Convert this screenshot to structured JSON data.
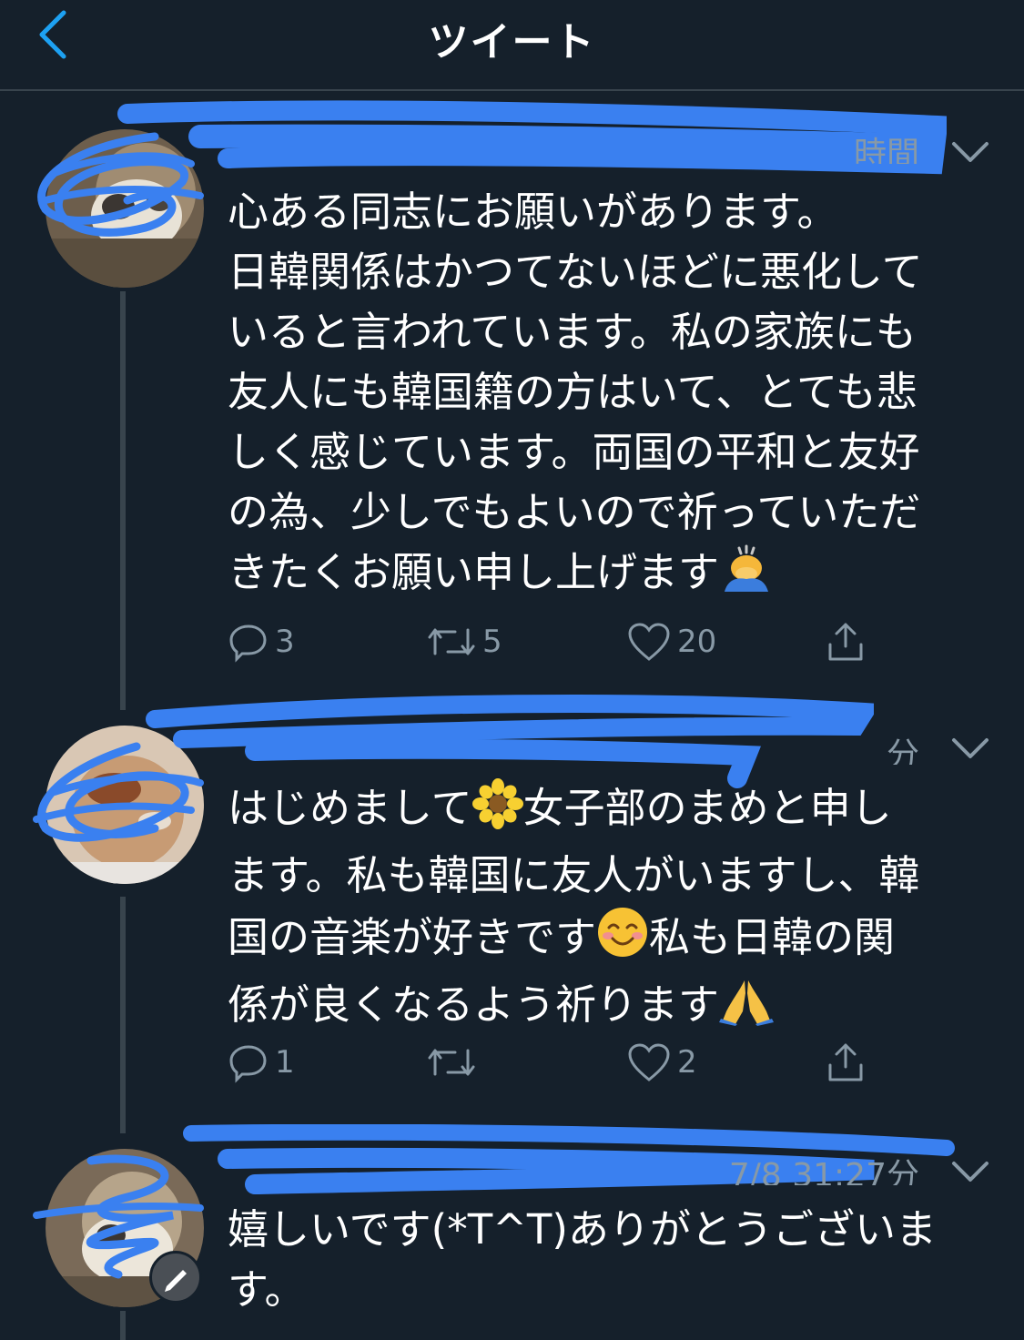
{
  "header": {
    "title": "ツイート",
    "back_icon": "chevron-left-icon"
  },
  "colors": {
    "accent": "#1da1f2",
    "background": "#15202b",
    "muted": "#8899a6",
    "scribble": "#3a80f0"
  },
  "tweets": [
    {
      "time_fragment": "時間",
      "lines": [
        "心ある同志にお願いがあります。",
        "日韓関係はかつてないほどに悪化して",
        "いると言われています。私の家族にも",
        "友人にも韓国籍の方はいて、とても悲",
        "しく感じています。両国の平和と友好",
        "の為、少しでもよいので祈っていただ",
        "きたくお願い申し上げます"
      ],
      "reply_count": "3",
      "retweet_count": "5",
      "like_count": "20"
    },
    {
      "time_fragment": "分",
      "lines": [
        "はじめまして",
        "女子部のまめと申し",
        "ます。私も韓国に友人がいますし、韓",
        "国の音楽が好きです",
        "私も日韓の関",
        "係が良くなるよう祈ります"
      ],
      "reply_count": "1",
      "retweet_count": "",
      "like_count": "2"
    },
    {
      "time_fragment": "7/8 31:27分",
      "lines": [
        "嬉しいです(*T^T)ありがとうございま",
        "す。"
      ]
    }
  ]
}
